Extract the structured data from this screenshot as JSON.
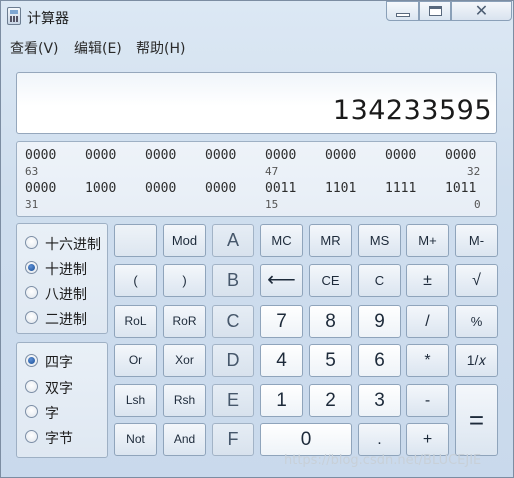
{
  "window": {
    "title": "计算器"
  },
  "menu": [
    "查看(V)",
    "编辑(E)",
    "帮助(H)"
  ],
  "display": {
    "value": "134233595"
  },
  "bits": {
    "row1": {
      "groups": [
        "0000",
        "0000",
        "0000",
        "0000",
        "0000",
        "0000",
        "0000",
        "0000"
      ],
      "index_left": "63",
      "index_mid": "47",
      "index_right": "32"
    },
    "row2": {
      "groups": [
        "0000",
        "1000",
        "0000",
        "0000",
        "0011",
        "1101",
        "1111",
        "1011"
      ],
      "index_left": "31",
      "index_mid": "15",
      "index_right": "0"
    }
  },
  "radix": [
    {
      "label": "十六进制",
      "selected": false
    },
    {
      "label": "十进制",
      "selected": true
    },
    {
      "label": "八进制",
      "selected": false
    },
    {
      "label": "二进制",
      "selected": false
    }
  ],
  "word": [
    {
      "label": "四字",
      "selected": true
    },
    {
      "label": "双字",
      "selected": false
    },
    {
      "label": "字",
      "selected": false
    },
    {
      "label": "字节",
      "selected": false
    }
  ],
  "keys": {
    "mod": "Mod",
    "a": "A",
    "mc": "MC",
    "mr": "MR",
    "ms": "MS",
    "mplus": "M+",
    "mminus": "M-",
    "lparen": "(",
    "rparen": ")",
    "b": "B",
    "backspace": "⟵",
    "ce": "CE",
    "c": "C",
    "plusminus": "±",
    "sqrt": "√",
    "rol": "RoL",
    "ror": "RoR",
    "cc": "C",
    "seven": "7",
    "eight": "8",
    "nine": "9",
    "divide": "/",
    "percent": "%",
    "or": "Or",
    "xor": "Xor",
    "d": "D",
    "four": "4",
    "five": "5",
    "six": "6",
    "multiply": "*",
    "reciprocal": "1/𝑥",
    "lsh": "Lsh",
    "rsh": "Rsh",
    "e": "E",
    "one": "1",
    "two": "2",
    "three": "3",
    "minus": "-",
    "equals": "=",
    "not": "Not",
    "and": "And",
    "f": "F",
    "zero": "0",
    "dot": ".",
    "plus": "+"
  },
  "watermark": "https://blog.csdn.net/BLUCEJIE"
}
